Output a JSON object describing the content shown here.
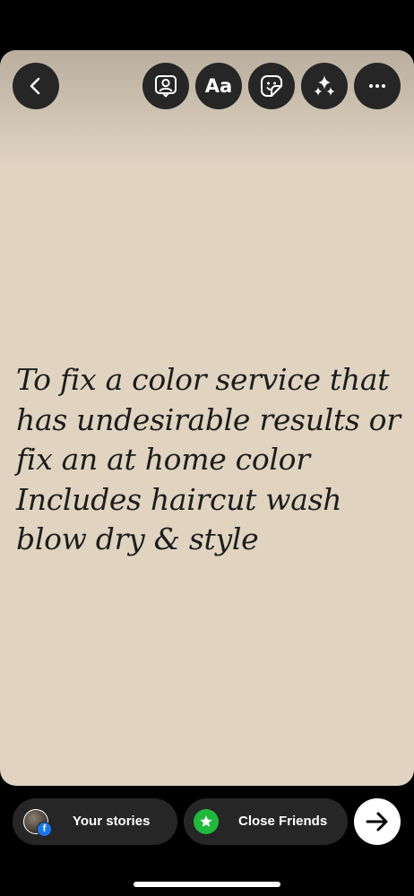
{
  "toolbar": {
    "back_icon": "chevron-left-icon",
    "mention_icon": "person-tag-icon",
    "text_button_label": "Aa",
    "sticker_icon": "sticker-icon",
    "effects_icon": "sparkles-icon",
    "more_icon": "more-horizontal-icon"
  },
  "story": {
    "background_color": "#e0d4c1",
    "text_lines": [
      "To fix a color service that",
      "has undesirable results or",
      "fix an at home color",
      "Includes haircut wash",
      "blow dry & style"
    ]
  },
  "share_bar": {
    "your_stories_label": "Your stories",
    "facebook_badge": "f",
    "close_friends_label": "Close Friends",
    "close_friends_icon": "star-icon",
    "close_friends_color": "#1fba3d",
    "next_icon": "arrow-right-icon"
  }
}
